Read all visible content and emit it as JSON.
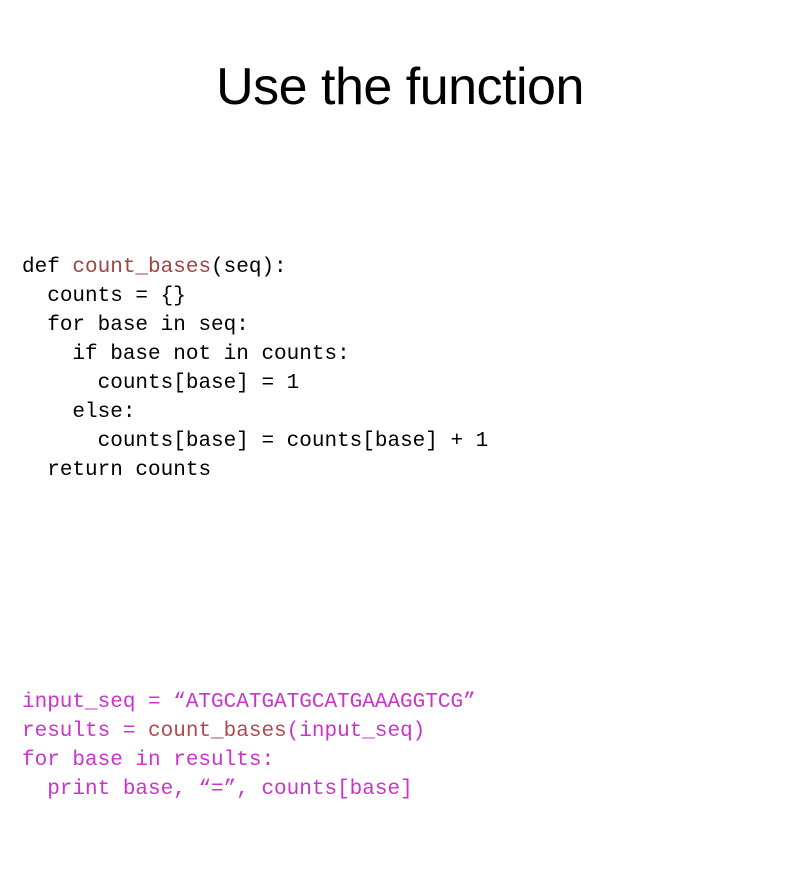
{
  "slide": {
    "title": "Use the function",
    "background_color": "#ffffff"
  },
  "colors": {
    "default_text": "#000000",
    "function_name": "#a24343",
    "example_text": "#cc33cc",
    "example_function_name": "#b3484f"
  },
  "code": {
    "definition": [
      {
        "id": "def-line-1",
        "indent": "",
        "tokens": [
          {
            "text": "def ",
            "color": "default"
          },
          {
            "text": "count_bases",
            "color": "function"
          },
          {
            "text": "(seq):",
            "color": "default"
          }
        ],
        "plain": "def count_bases(seq):"
      },
      {
        "id": "def-line-2",
        "indent": "  ",
        "tokens": [
          {
            "text": "counts = {}",
            "color": "default"
          }
        ],
        "plain": "  counts = {}"
      },
      {
        "id": "def-line-3",
        "indent": "  ",
        "tokens": [
          {
            "text": "for base in seq:",
            "color": "default"
          }
        ],
        "plain": "  for base in seq:"
      },
      {
        "id": "def-line-4",
        "indent": "    ",
        "tokens": [
          {
            "text": "if base not in counts:",
            "color": "default"
          }
        ],
        "plain": "    if base not in counts:"
      },
      {
        "id": "def-line-5",
        "indent": "      ",
        "tokens": [
          {
            "text": "counts[base] = 1",
            "color": "default"
          }
        ],
        "plain": "      counts[base] = 1"
      },
      {
        "id": "def-line-6",
        "indent": "    ",
        "tokens": [
          {
            "text": "else:",
            "color": "default"
          }
        ],
        "plain": "    else:"
      },
      {
        "id": "def-line-7",
        "indent": "      ",
        "tokens": [
          {
            "text": "counts[base] = counts[base] + 1",
            "color": "default"
          }
        ],
        "plain": "      counts[base] = counts[base] + 1"
      },
      {
        "id": "def-line-8",
        "indent": "  ",
        "tokens": [
          {
            "text": "return counts",
            "color": "default"
          }
        ],
        "plain": "  return counts"
      }
    ],
    "usage": [
      {
        "id": "use-line-1",
        "indent": "",
        "tokens": [
          {
            "text": "input_seq = “ATGCATGATGCATGAAAGGTCG”",
            "color": "magenta"
          }
        ],
        "plain": "input_seq = “ATGCATGATGCATGAAAGGTCG”"
      },
      {
        "id": "use-line-2",
        "indent": "",
        "tokens": [
          {
            "text": "results = ",
            "color": "magenta"
          },
          {
            "text": "count_bases",
            "color": "magenta-function"
          },
          {
            "text": "(input_seq)",
            "color": "magenta"
          }
        ],
        "plain": "results = count_bases(input_seq)"
      },
      {
        "id": "use-line-3",
        "indent": "",
        "tokens": [
          {
            "text": "for base in results:",
            "color": "magenta"
          }
        ],
        "plain": "for base in results:"
      },
      {
        "id": "use-line-4",
        "indent": "  ",
        "tokens": [
          {
            "text": "print base, “=”, counts[base]",
            "color": "magenta"
          }
        ],
        "plain": "  print base, “=”, counts[base]"
      }
    ],
    "sequence_literal": "ATGCATGATGCATGAAAGGTCG",
    "function_name": "count_bases"
  }
}
